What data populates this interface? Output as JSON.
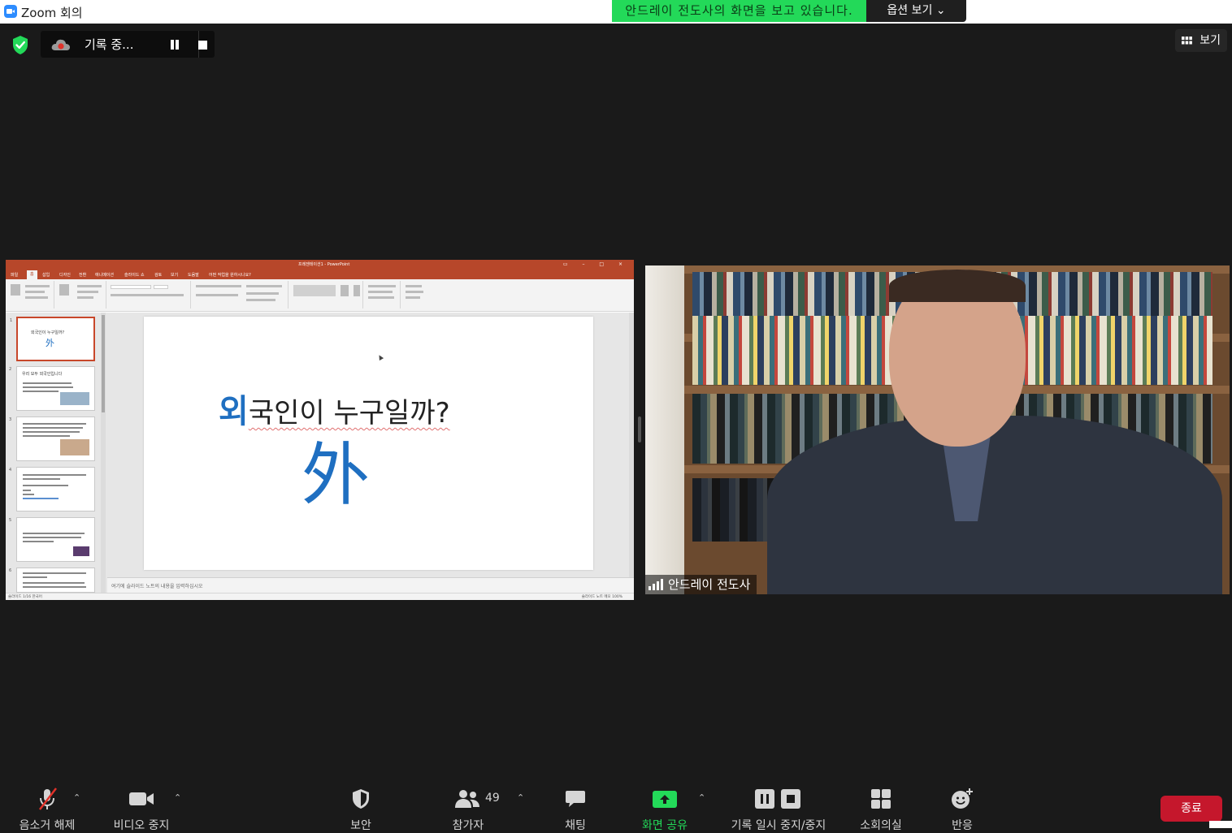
{
  "window": {
    "title": "Zoom 회의"
  },
  "share_banner": {
    "message": "안드레이 전도사의 화면을 보고 있습니다.",
    "options_label": "옵션 보기"
  },
  "recording": {
    "label": "기록 중..."
  },
  "view_button": {
    "label": "보기"
  },
  "shared_screen": {
    "app_title": "프레젠테이션1 - PowerPoint",
    "tabs": [
      "파일",
      "홈",
      "삽입",
      "디자인",
      "전환",
      "애니메이션",
      "슬라이드 쇼",
      "검토",
      "보기",
      "도움말",
      "어떤 작업을 원하시나요?"
    ],
    "slide_heading_accent": "외",
    "slide_heading_rest": "국인이 누구일까?",
    "slide_big_char": "外",
    "notes_placeholder": "여기에 슬라이드 노트의 내용을 입력하십시오",
    "status_left": "슬라이드 1/16   한국어",
    "status_right": "슬라이드 노트   메모   100%",
    "thumbnail_numbers": [
      "1",
      "2",
      "3",
      "4",
      "5",
      "6"
    ],
    "thumbnail_titles": [
      "외국인이 누구일까?",
      "우리 모두 외국인입니다",
      "",
      "",
      "",
      ""
    ]
  },
  "video": {
    "participant_name": "안드레이 전도사"
  },
  "toolbar": {
    "mute": "음소거 해제",
    "video": "비디오 중지",
    "security": "보안",
    "participants": "참가자",
    "participant_count": "49",
    "chat": "채팅",
    "share": "화면 공유",
    "record": "기록 일시 중지/중지",
    "breakout": "소회의실",
    "reactions": "반응",
    "end": "종료"
  },
  "colors": {
    "banner_green": "#23d959",
    "share_green": "#23d959",
    "end_red": "#c5172c",
    "ppt_accent": "#b7472a",
    "slide_blue": "#1f6fc1"
  }
}
